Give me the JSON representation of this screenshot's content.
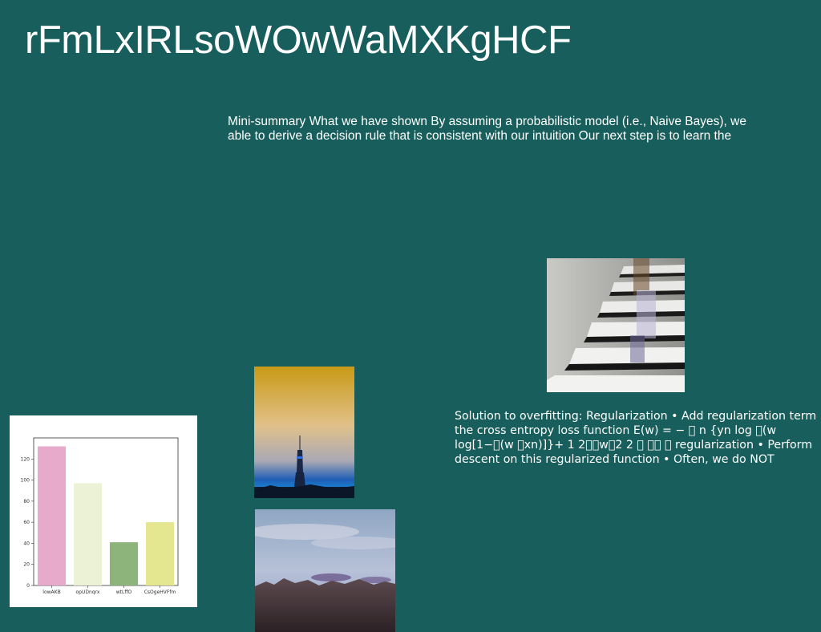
{
  "slide": {
    "title": "rFmLxIRLsoWOwWaMXKgHCF",
    "summary": "Mini-summary What we have shown By assuming a probabilistic model (i.e., Naive Bayes), we able to derive a decision rule that is consistent with our intuition Our next step is to learn the",
    "solution": "Solution to overfitting: Regularization • Add regularization term the cross entropy loss function E(w) = − \u0000 n {yn log \u0000(w log[1−\u0000(w \u0000xn)]}+ 1 2\u0000\u0000w\u00002 2 \u0000 \u0000\u0000 \u0000 regularization • Perform descent on this regularized function • Often, we do NOT",
    "background_color": "#175e5c"
  },
  "images": [
    {
      "name": "stairs-photo"
    },
    {
      "name": "tower-photo"
    },
    {
      "name": "landscape-photo"
    }
  ],
  "chart_data": {
    "type": "bar",
    "categories": [
      "lowAKB",
      "opUDnqrx",
      "wtLffO",
      "CsOgeHVFfm"
    ],
    "values": [
      132,
      97,
      41,
      60
    ],
    "colors": [
      "#e8aacb",
      "#ebf2d6",
      "#8db47a",
      "#e4e78f"
    ],
    "ylim": [
      0,
      140
    ],
    "yticks": [
      0,
      20,
      40,
      60,
      80,
      100,
      120
    ],
    "title": "",
    "xlabel": "",
    "ylabel": ""
  }
}
